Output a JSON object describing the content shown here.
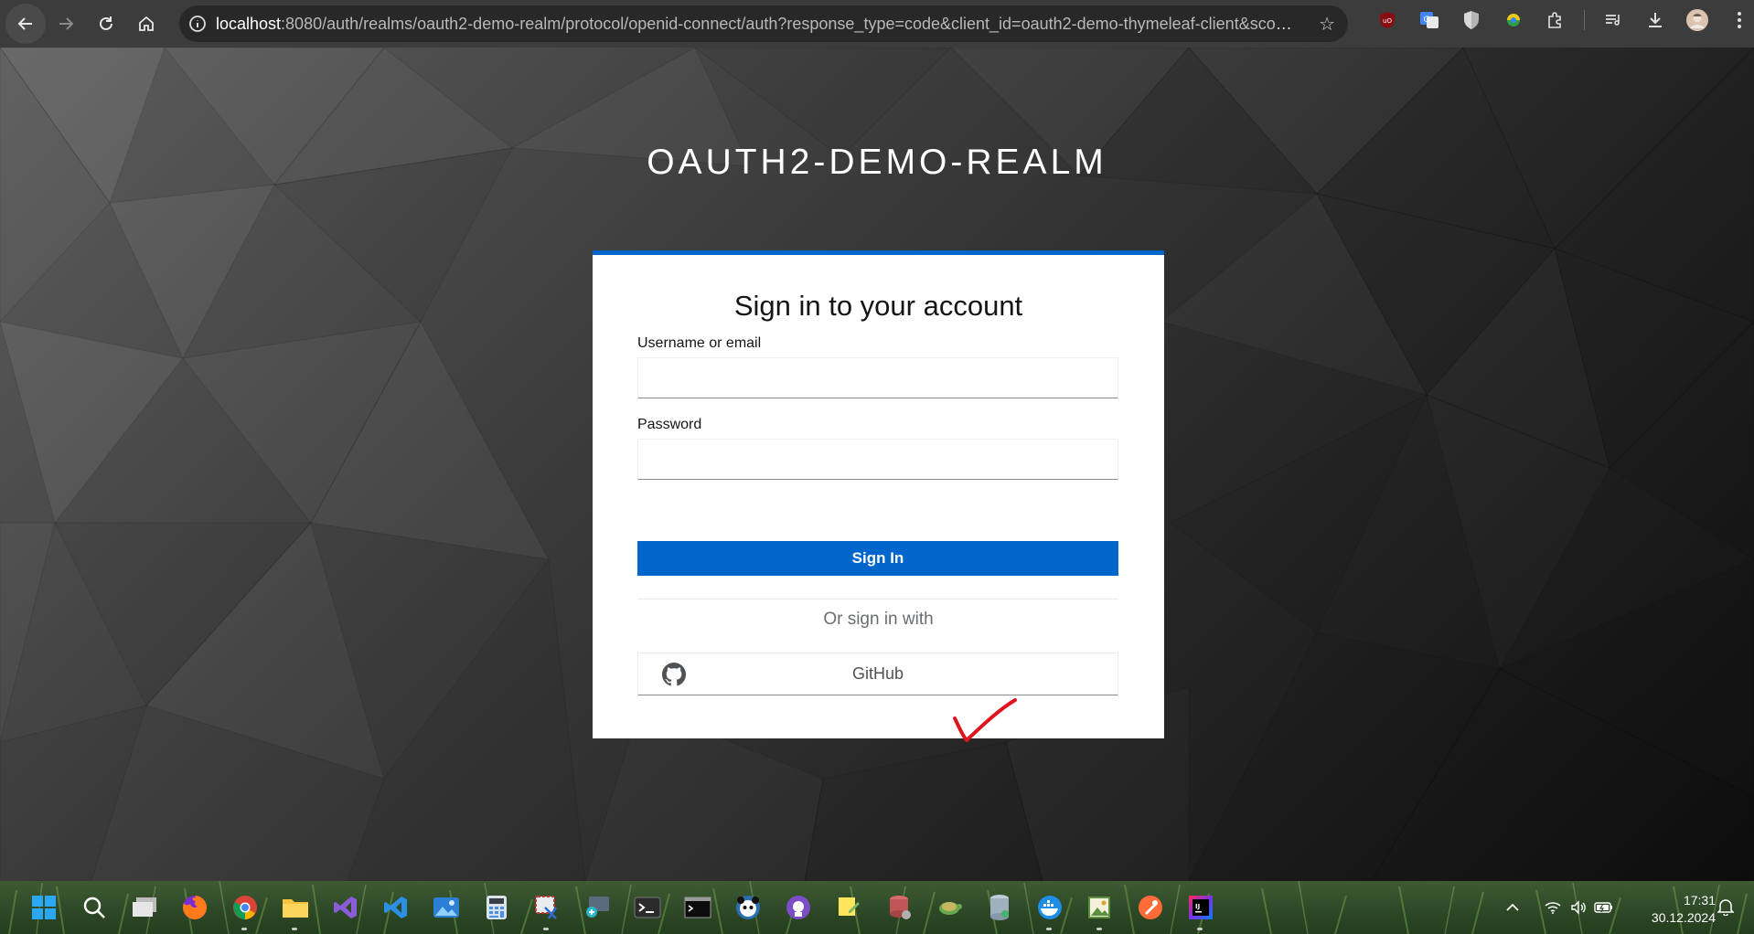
{
  "browser": {
    "url_host": "localhost",
    "url_rest": ":8080/auth/realms/oauth2-demo-realm/protocol/openid-connect/auth?response_type=code&client_id=oauth2-demo-thymeleaf-client&scop..."
  },
  "login": {
    "realm_title": "OAUTH2-DEMO-REALM",
    "card_title": "Sign in to your account",
    "username_label": "Username or email",
    "username_value": "",
    "password_label": "Password",
    "password_value": "",
    "sign_in_label": "Sign In",
    "or_sign_in_with": "Or sign in with",
    "github_label": "GitHub"
  },
  "colors": {
    "accent": "#0066cc",
    "annotation": "#e0141e"
  },
  "taskbar": {
    "time": "17:31",
    "date": "30.12.2024"
  }
}
